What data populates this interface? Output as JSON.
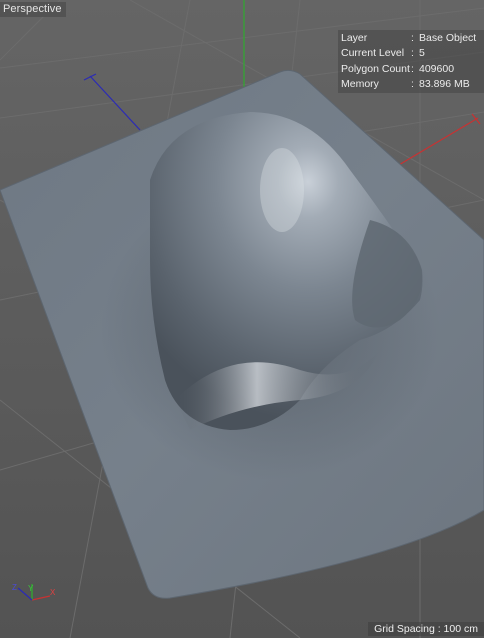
{
  "viewport": {
    "name": "Perspective"
  },
  "hud": {
    "rows": [
      {
        "key": "Layer",
        "sep": ":",
        "value": "Base Object"
      },
      {
        "key": "Current Level",
        "sep": ":",
        "value": "5"
      },
      {
        "key": "Polygon Count",
        "sep": ":",
        "value": "409600"
      },
      {
        "key": "Memory",
        "sep": ":",
        "value": "83.896 MB"
      }
    ]
  },
  "status": {
    "grid_spacing": "Grid Spacing : 100 cm"
  },
  "gizmo": {
    "x_label": "X",
    "y_label": "Y",
    "z_label": "Z"
  },
  "colors": {
    "axis_x": "#c83232",
    "axis_y": "#2faa2f",
    "axis_z": "#2b2bb5",
    "mesh": "#7a8591",
    "floor": "#5a5a5a"
  }
}
